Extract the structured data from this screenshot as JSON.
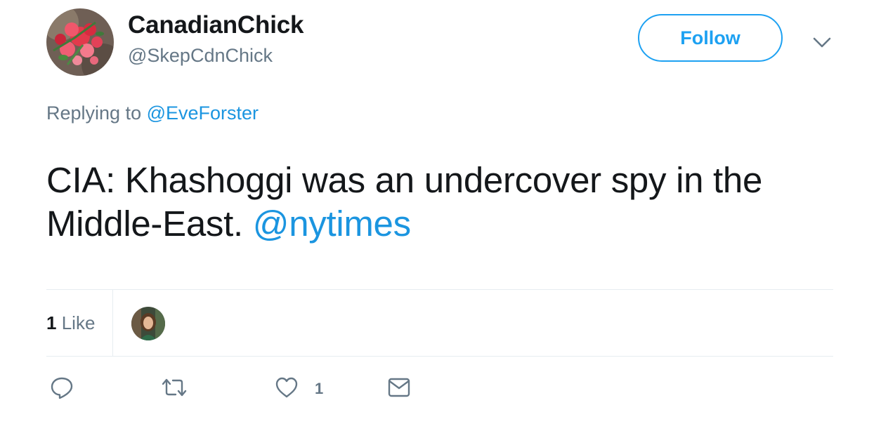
{
  "user": {
    "display_name": "CanadianChick",
    "handle": "@SkepCdnChick",
    "avatar_icon": "rose-petals-avatar"
  },
  "follow_button": {
    "label": "Follow"
  },
  "menu": {
    "icon": "chevron-down-icon"
  },
  "reply_context": {
    "prefix": "Replying to",
    "mention": "@EveForster"
  },
  "tweet": {
    "text": "CIA: Khashoggi was an undercover spy in the Middle-East.",
    "mention": "@nytimes"
  },
  "stats": {
    "like_count": "1",
    "like_label": "Like"
  },
  "actions": {
    "reply_icon": "reply-icon",
    "retweet_icon": "retweet-icon",
    "like_icon": "heart-icon",
    "like_count": "1",
    "dm_icon": "envelope-icon"
  },
  "colors": {
    "accent": "#1da1f2",
    "link": "#1b95e0",
    "secondary_text": "#657786",
    "divider": "#e6ecf0"
  }
}
